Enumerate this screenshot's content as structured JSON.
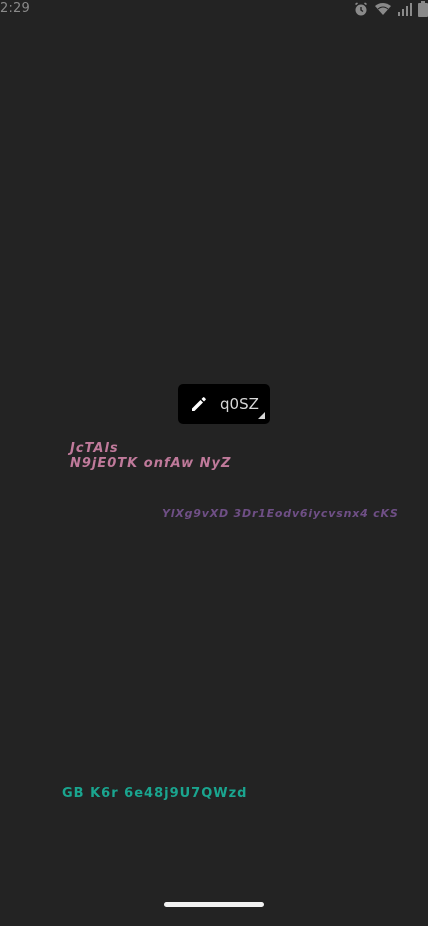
{
  "status_bar": {
    "time": "2:29",
    "icons": [
      "alarm-icon",
      "wifi-icon",
      "signal-icon",
      "battery-icon"
    ]
  },
  "edit_chip": {
    "icon": "pencil-icon",
    "label": "q0SZ"
  },
  "texts": {
    "pink_line1": "JcTAls",
    "pink_line2": "N9jE0TK onfAw NyZ",
    "purple": "YlXg9vXD 3Dr1Eodv6iycvsnx4 cKS",
    "teal": "GB K6r 6e48j9U7QWzd"
  },
  "colors": {
    "background": "#232323",
    "pink": "#c07a9b",
    "purple": "#6f4f86",
    "teal": "#1aa58f",
    "chip_bg": "#000000"
  }
}
